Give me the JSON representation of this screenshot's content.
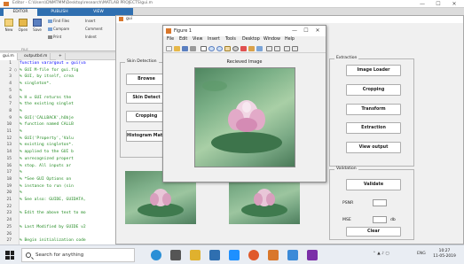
{
  "editor": {
    "title": "Editor - C:\\Users\\DNMTMM\\Desktop\\research\\MATLAB PROJECTS\\gui.m",
    "ribbon_tabs": [
      "EDITOR",
      "PUBLISH",
      "VIEW"
    ],
    "ribbon": {
      "new": "New",
      "open": "Open",
      "save": "Save",
      "find_files": "Find Files",
      "compare": "Compare",
      "print": "Print",
      "insert": "Insert",
      "comment": "Comment",
      "indent": "Indent",
      "group_file": "FILE"
    },
    "doc_tabs": [
      "gui.m",
      "outputbd.m",
      "+"
    ],
    "code_lines": [
      {
        "n": "1",
        "m": "",
        "t": "function varargout = gui(va"
      },
      {
        "n": "2",
        "m": "○",
        "t": "% GUI M-file for gui.fig"
      },
      {
        "n": "3",
        "m": "",
        "t": "%      GUI, by itself, crea"
      },
      {
        "n": "4",
        "m": "",
        "t": "%      singleton*."
      },
      {
        "n": "5",
        "m": "",
        "t": "%"
      },
      {
        "n": "6",
        "m": "",
        "t": "%      H = GUI returns the"
      },
      {
        "n": "7",
        "m": "",
        "t": "%      the existing singlet"
      },
      {
        "n": "8",
        "m": "",
        "t": "%"
      },
      {
        "n": "9",
        "m": "",
        "t": "%      GUI('CALLBACK',hObje"
      },
      {
        "n": "10",
        "m": "",
        "t": "%      function named CALLB"
      },
      {
        "n": "11",
        "m": "",
        "t": "%"
      },
      {
        "n": "12",
        "m": "",
        "t": "%      GUI('Property','Valu"
      },
      {
        "n": "13",
        "m": "",
        "t": "%      existing singleton*."
      },
      {
        "n": "14",
        "m": "",
        "t": "%      applied to the GUI b"
      },
      {
        "n": "15",
        "m": "",
        "t": "%      unrecognized propert"
      },
      {
        "n": "16",
        "m": "",
        "t": "%      stop.  All inputs ar"
      },
      {
        "n": "17",
        "m": "",
        "t": "%"
      },
      {
        "n": "18",
        "m": "",
        "t": "%      *See GUI Options on"
      },
      {
        "n": "19",
        "m": "",
        "t": "%      instance to run (sin"
      },
      {
        "n": "20",
        "m": "",
        "t": "%"
      },
      {
        "n": "21",
        "m": "",
        "t": "% See also: GUIDE, GUIDATA,"
      },
      {
        "n": "22",
        "m": "",
        "t": ""
      },
      {
        "n": "23",
        "m": "",
        "t": "% Edit the above text to mo"
      },
      {
        "n": "24",
        "m": "",
        "t": ""
      },
      {
        "n": "25",
        "m": "",
        "t": "% Last Modified by GUIDE v2"
      },
      {
        "n": "26",
        "m": "",
        "t": ""
      },
      {
        "n": "27",
        "m": "",
        "t": "% Begin initialization code"
      }
    ]
  },
  "gui": {
    "title": "gui",
    "skin_panel": {
      "title": "Skin Detection",
      "buttons": [
        "Browse",
        "Skin Detect",
        "Cropping",
        "Histogram Matching"
      ]
    },
    "extraction_panel": {
      "title": "Extraction",
      "buttons": [
        "Image Loader",
        "Cropping",
        "Transform",
        "Extraction",
        "View output"
      ]
    },
    "validation_panel": {
      "title": "Validation",
      "validate": "Validate",
      "psnr_label": "PSNR",
      "mse_label": "MSE",
      "db_unit": "db",
      "clear": "Clear"
    }
  },
  "figure": {
    "title": "Figure 1",
    "menus": [
      "File",
      "Edit",
      "View",
      "Insert",
      "Tools",
      "Desktop",
      "Window",
      "Help"
    ],
    "axes_title": "Recieved Image",
    "controls": {
      "minimize": "—",
      "maximize": "☐",
      "close": "✕"
    }
  },
  "taskbar": {
    "search_placeholder": "Search for anything",
    "time": "10:27",
    "date": "11-05-2019",
    "lang": "ENG"
  },
  "colors": {
    "accent": "#2f6fb0",
    "matlab_orange": "#d9772b",
    "comment_green": "#228b22"
  }
}
